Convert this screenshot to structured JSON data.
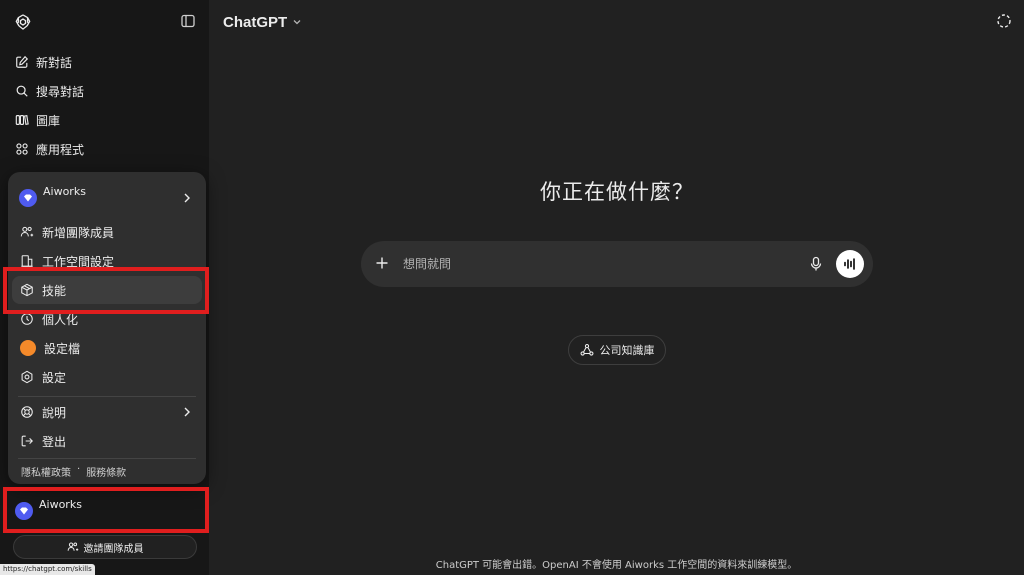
{
  "sidebar": {
    "nav": [
      {
        "label": "新對話",
        "icon": "edit-icon"
      },
      {
        "label": "搜尋對話",
        "icon": "search-icon"
      },
      {
        "label": "圖庫",
        "icon": "library-icon"
      },
      {
        "label": "應用程式",
        "icon": "apps-icon"
      }
    ],
    "menu": {
      "workspace_name": "Aiworks",
      "items": [
        {
          "label": "新增團隊成員",
          "icon": "add-member-icon"
        },
        {
          "label": "工作空間設定",
          "icon": "workspace-settings-icon"
        },
        {
          "label": "技能",
          "icon": "skills-icon"
        },
        {
          "label": "個人化",
          "icon": "personalization-icon"
        },
        {
          "label": "設定檔",
          "icon": "profile-icon"
        },
        {
          "label": "設定",
          "icon": "gear-icon"
        },
        {
          "label": "說明",
          "icon": "help-icon"
        },
        {
          "label": "登出",
          "icon": "logout-icon"
        }
      ],
      "privacy": "隱私權政策",
      "legal_sep": "·",
      "terms": "服務條款"
    },
    "bottom_workspace": "Aiworks",
    "invite_label": "邀請團隊成員",
    "status_url": "https://chatgpt.com/skills"
  },
  "main": {
    "model_name": "ChatGPT",
    "hero": "你正在做什麼？",
    "composer_placeholder": "想問就問",
    "knowledge_pill": "公司知識庫",
    "footer": "ChatGPT 可能會出錯。OpenAI 不會使用 Aiworks 工作空間的資料來訓練模型。"
  },
  "colors": {
    "background": "#212121",
    "sidebar": "#171717",
    "menu": "#2f2f2f",
    "highlight": "#e01e1e",
    "workspace_avatar": "#4f5bf0",
    "profile_dot": "#f58a2a"
  }
}
